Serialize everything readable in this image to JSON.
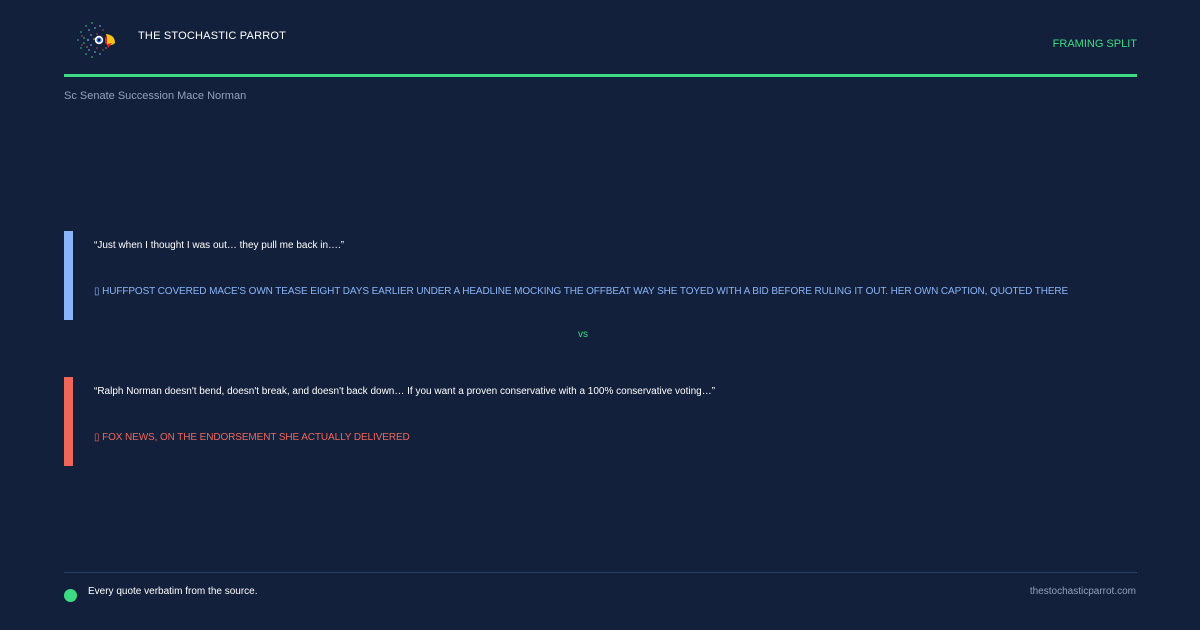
{
  "header": {
    "brand": "THE STOCHASTIC PARROT",
    "tag": "FRAMING SPLIT",
    "logo_icon": "parrot-logo-icon"
  },
  "topic": "Sc Senate Succession Mace Norman",
  "quotes": [
    {
      "text": "“Just when I thought I was out… they pull me back in….”",
      "source": "▯ HUFFPOST COVERED MACE'S OWN TEASE EIGHT DAYS EARLIER UNDER A HEADLINE MOCKING THE OFFBEAT WAY SHE TOYED WITH A BID BEFORE RULING IT OUT. HER OWN CAPTION, QUOTED THERE",
      "color": "#8ab4f8"
    },
    {
      "text": "“Ralph Norman doesn't bend, doesn't break, and doesn't back down… If you want a proven conservative with a 100% conservative voting…”",
      "source": "▯ FOX NEWS, ON THE ENDORSEMENT SHE ACTUALLY DELIVERED",
      "color": "#f0665a"
    }
  ],
  "vs_label": "vs",
  "footer": {
    "note": "Every quote verbatim from the source.",
    "site": "thestochasticparrot.com"
  },
  "colors": {
    "background": "#13203b",
    "accent": "#3ddc84"
  }
}
